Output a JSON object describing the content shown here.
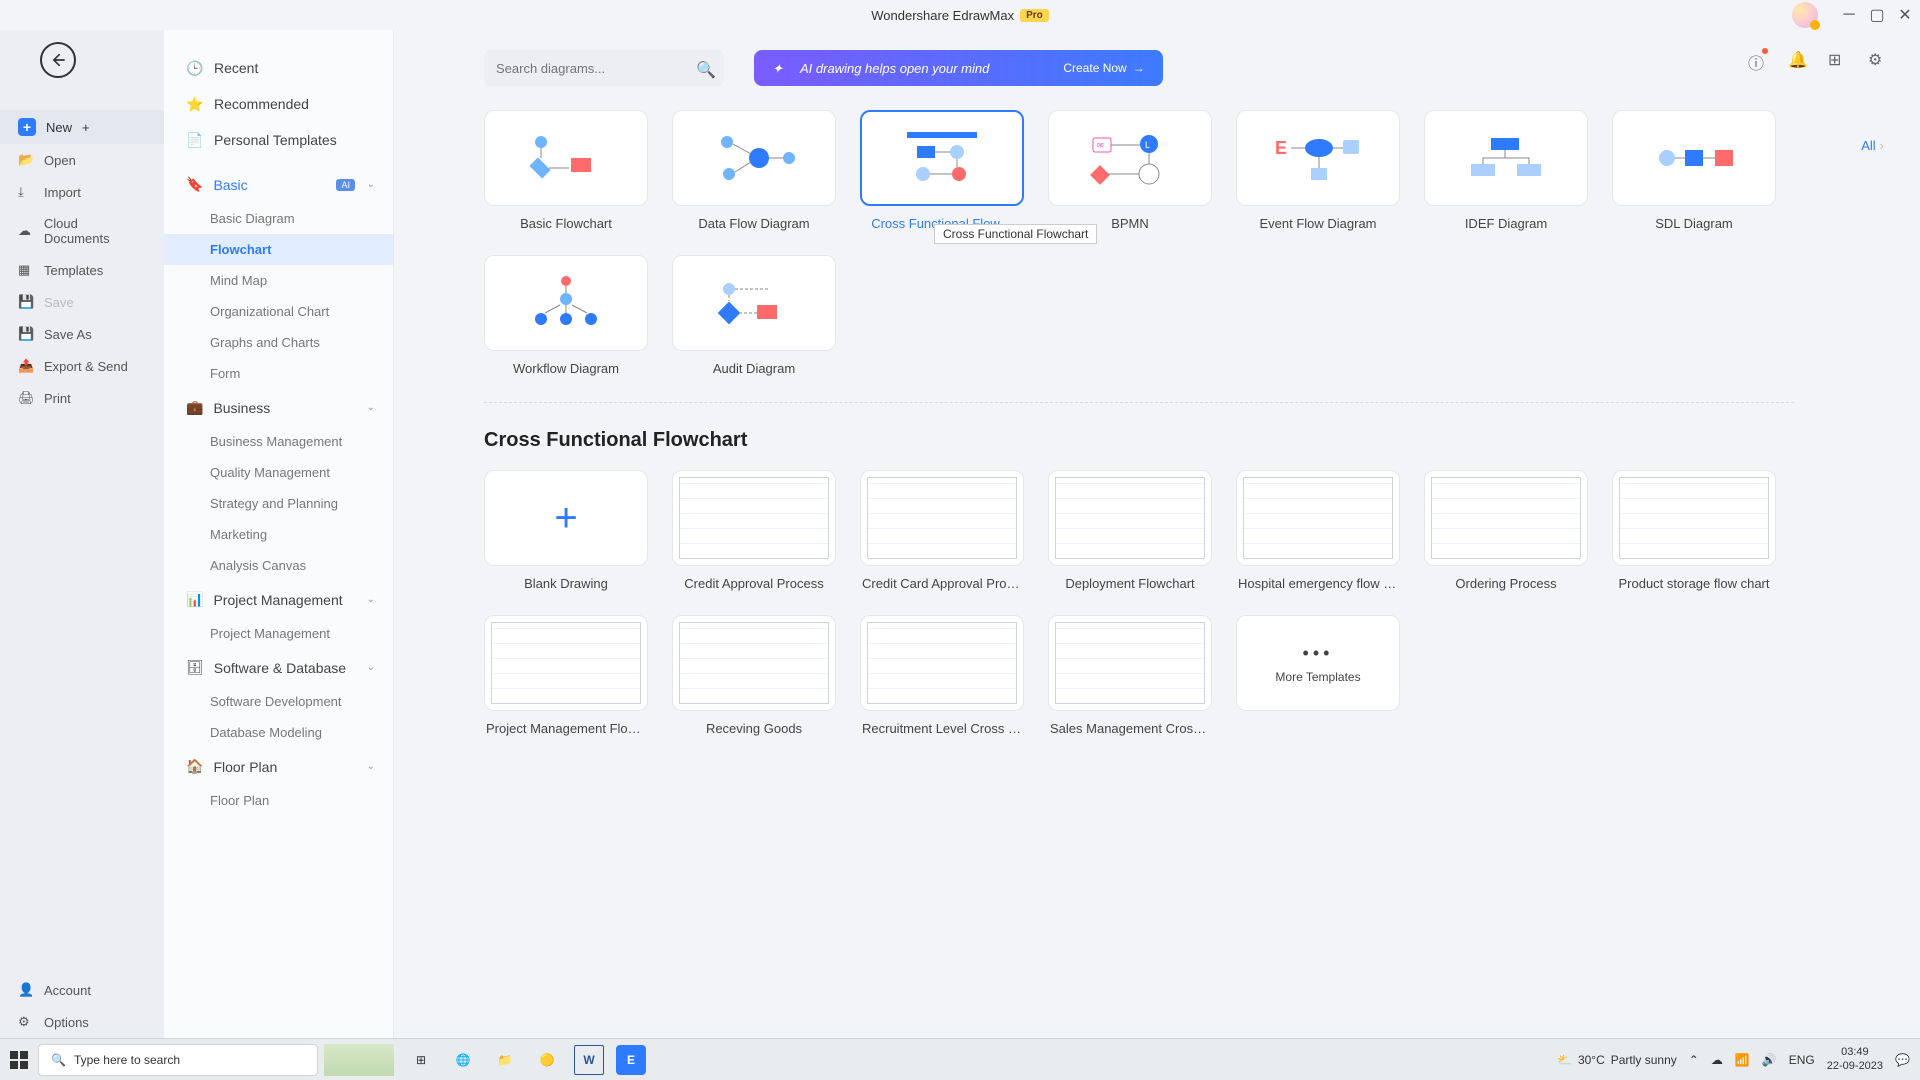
{
  "title": {
    "app": "Wondershare EdrawMax",
    "pro": "Pro"
  },
  "sidebar1": {
    "new": "New",
    "open": "Open",
    "import": "Import",
    "cloud": "Cloud Documents",
    "templates": "Templates",
    "save": "Save",
    "saveas": "Save As",
    "export": "Export & Send",
    "print": "Print",
    "account": "Account",
    "options": "Options"
  },
  "sidebar2": {
    "recent": "Recent",
    "recommended": "Recommended",
    "personal": "Personal Templates",
    "basic": {
      "head": "Basic",
      "ai": "AI",
      "items": [
        "Basic Diagram",
        "Flowchart",
        "Mind Map",
        "Organizational Chart",
        "Graphs and Charts",
        "Form"
      ],
      "selected": 1
    },
    "business": {
      "head": "Business",
      "items": [
        "Business Management",
        "Quality Management",
        "Strategy and Planning",
        "Marketing",
        "Analysis Canvas"
      ]
    },
    "pm": {
      "head": "Project Management",
      "items": [
        "Project Management"
      ]
    },
    "sd": {
      "head": "Software & Database",
      "items": [
        "Software Development",
        "Database Modeling"
      ]
    },
    "floor": {
      "head": "Floor Plan",
      "items": [
        "Floor Plan"
      ]
    }
  },
  "search": {
    "placeholder": "Search diagrams..."
  },
  "ai_banner": {
    "text": "AI drawing helps open your mind",
    "cta": "Create Now"
  },
  "all_link": "All",
  "row1": [
    {
      "label": "Basic Flowchart",
      "svg": "flow1"
    },
    {
      "label": "Data Flow Diagram",
      "svg": "dfd"
    },
    {
      "label": "Cross Functional Flow…",
      "svg": "cross",
      "selected": true
    },
    {
      "label": "BPMN",
      "svg": "bpmn"
    },
    {
      "label": "Event Flow Diagram",
      "svg": "event"
    },
    {
      "label": "IDEF Diagram",
      "svg": "idef"
    },
    {
      "label": "SDL Diagram",
      "svg": "sdl"
    }
  ],
  "row2": [
    {
      "label": "Workflow Diagram",
      "svg": "workflow"
    },
    {
      "label": "Audit Diagram",
      "svg": "audit"
    }
  ],
  "tooltip": "Cross Functional Flowchart",
  "section_title": "Cross Functional Flowchart",
  "templates": [
    {
      "label": "Blank Drawing",
      "blank": true
    },
    {
      "label": "Credit Approval Process"
    },
    {
      "label": "Credit Card Approval Proc…"
    },
    {
      "label": "Deployment Flowchart"
    },
    {
      "label": "Hospital emergency flow c…"
    },
    {
      "label": "Ordering Process"
    },
    {
      "label": "Product storage flow chart"
    },
    {
      "label": "Project Management Flow…"
    },
    {
      "label": "Receving Goods"
    },
    {
      "label": "Recruitment Level Cross F…"
    },
    {
      "label": "Sales Management Crossf…"
    },
    {
      "label": "More Templates",
      "more": true
    }
  ],
  "taskbar": {
    "search": "Type here to search",
    "temp": "30°C",
    "weather": "Partly sunny",
    "time": "03:49",
    "date": "22-09-2023"
  }
}
